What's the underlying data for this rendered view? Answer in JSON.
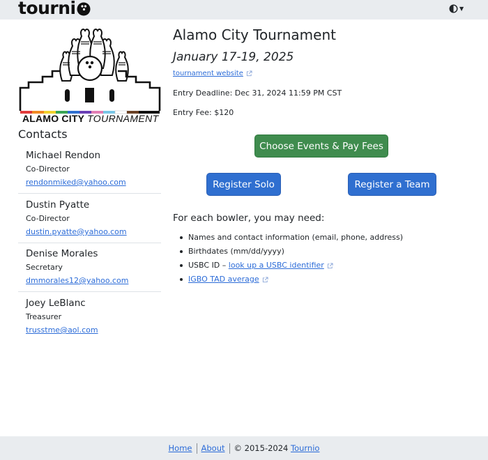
{
  "navbar": {
    "brand": "tourni",
    "theme_icon": "half-circle-icon"
  },
  "logo": {
    "city": "ALAMO CITY",
    "word": "TOURNAMENT",
    "stripe_colors": [
      "#e23b3b",
      "#f08a24",
      "#f2d22e",
      "#3aa655",
      "#2f6fd0",
      "#6a3fb5",
      "#e37fb4",
      "#79c6e6",
      "#ffffff",
      "#6b4226",
      "#111111"
    ]
  },
  "sidebar": {
    "heading": "Contacts",
    "contacts": [
      {
        "name": "Michael Rendon",
        "role": "Co-Director",
        "email": "rendonmiked@yahoo.com"
      },
      {
        "name": "Dustin Pyatte",
        "role": "Co-Director",
        "email": "dustin.pyatte@yahoo.com"
      },
      {
        "name": "Denise Morales",
        "role": "Secretary",
        "email": "dmmorales12@yahoo.com"
      },
      {
        "name": "Joey LeBlanc",
        "role": "Treasurer",
        "email": "trusstme@aol.com"
      }
    ]
  },
  "tournament": {
    "title": "Alamo City Tournament",
    "dates": "January 17-19, 2025",
    "website_link": "tournament website",
    "deadline": "Entry Deadline: Dec 31, 2024 11:59 PM CST",
    "fee": "Entry Fee: $120"
  },
  "actions": {
    "choose_events": "Choose Events & Pay Fees",
    "register_solo": "Register Solo",
    "register_team": "Register a Team"
  },
  "needs": {
    "heading": "For each bowler, you may need:",
    "item1": "Names and contact information (email, phone, address)",
    "item2": "Birthdates (mm/dd/yyyy)",
    "item3_prefix": "USBC ID – ",
    "item3_link": "look up a USBC identifier",
    "item4_link": "IGBO TAD average"
  },
  "footer": {
    "home": "Home",
    "about": "About",
    "copyright": "© 2015-2024 ",
    "tournio": "Tournio"
  },
  "colors": {
    "green_button": "#3f8c4e",
    "blue_button": "#2f6fd0",
    "link": "#2c6cd8",
    "bar_background": "#e9ecef"
  }
}
